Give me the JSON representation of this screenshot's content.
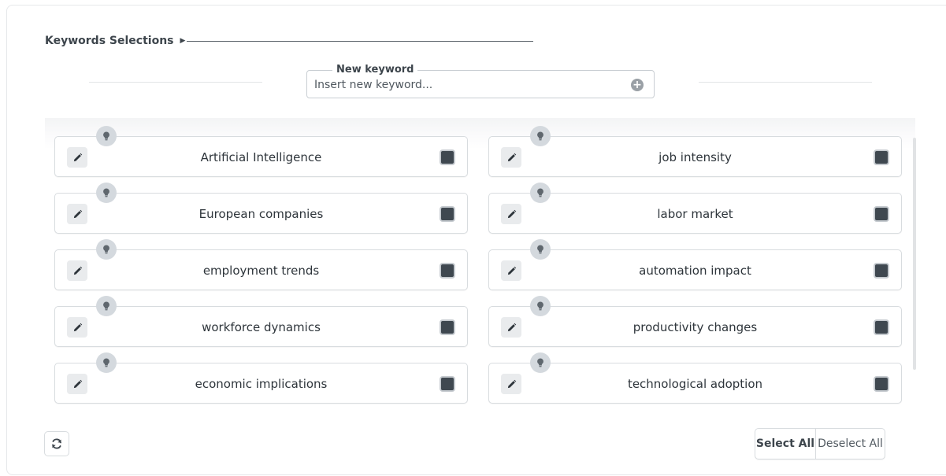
{
  "section": {
    "title": "Keywords Selections"
  },
  "new_keyword": {
    "legend": "New keyword",
    "placeholder": "Insert new keyword..."
  },
  "keywords": [
    {
      "label": "Artificial Intelligence",
      "checked": false
    },
    {
      "label": "job intensity",
      "checked": false
    },
    {
      "label": "European companies",
      "checked": false
    },
    {
      "label": "labor market",
      "checked": false
    },
    {
      "label": "employment trends",
      "checked": false
    },
    {
      "label": "automation impact",
      "checked": false
    },
    {
      "label": "workforce dynamics",
      "checked": false
    },
    {
      "label": "productivity changes",
      "checked": false
    },
    {
      "label": "economic implications",
      "checked": false
    },
    {
      "label": "technological adoption",
      "checked": false
    }
  ],
  "actions": {
    "select_all": "Select All",
    "deselect_all": "Deselect All"
  },
  "icons": {
    "section_arrow": "arrow-right-icon",
    "add": "plus-circle-icon",
    "edit": "pencil-icon",
    "hint": "lightbulb-icon",
    "refresh": "refresh-icon"
  },
  "colors": {
    "checkbox_fill": "#3f4850",
    "bulb_bg": "#d4d9de",
    "edit_bg": "#e9ebed"
  }
}
